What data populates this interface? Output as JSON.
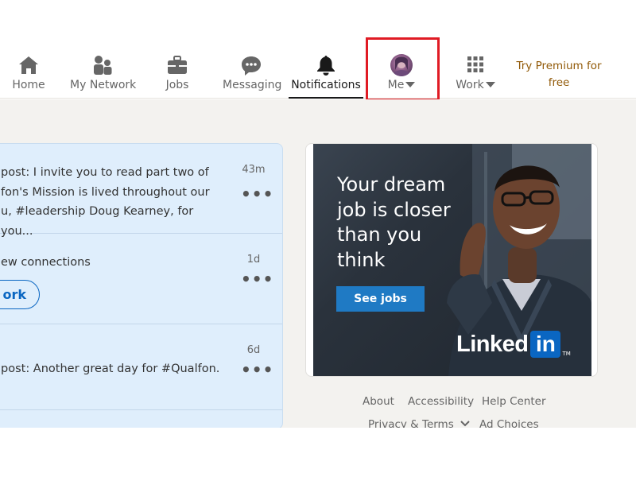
{
  "nav": {
    "home": {
      "label": "Home",
      "icon": "home-icon"
    },
    "network": {
      "label": "My Network",
      "icon": "people-icon"
    },
    "jobs": {
      "label": "Jobs",
      "icon": "briefcase-icon"
    },
    "messaging": {
      "label": "Messaging",
      "icon": "chat-icon"
    },
    "notifications": {
      "label": "Notifications",
      "icon": "bell-icon",
      "active": true
    },
    "me": {
      "label": "Me",
      "icon": "chevron-down-icon"
    },
    "work": {
      "label": "Work",
      "icon": "grid-icon"
    },
    "premium": {
      "line1": "Try Premium for",
      "line2": "free"
    }
  },
  "notifications": [
    {
      "text": "post: I invite you to read part two of fon's Mission is lived throughout our u, #leadership Doug Kearney, for you...",
      "line1": "post: I invite you to read part two of",
      "line2": "fon's Mission is lived throughout our",
      "line3": "u, #leadership Doug Kearney, for you...",
      "time": "43m",
      "more": "•••"
    },
    {
      "text": "ew connections",
      "time": "1d",
      "more": "•••",
      "button": "ork"
    },
    {
      "text": "post: Another great day for #Qualfon.",
      "time": "6d",
      "more": "•••"
    }
  ],
  "ad": {
    "headline_1": "Your dream",
    "headline_2": "job is closer",
    "headline_3": "than you",
    "headline_4": "think",
    "cta": "See jobs",
    "logo_word": "Linked",
    "logo_box": "in",
    "logo_tm": "TM"
  },
  "footer": {
    "about": "About",
    "accessibility": "Accessibility",
    "help": "Help Center",
    "privacy": "Privacy & Terms",
    "adchoices": "Ad Choices"
  },
  "colors": {
    "accent": "#0a66c2",
    "highlight": "#e01b24",
    "premium": "#915907",
    "notif_bg": "#dfeefc"
  }
}
